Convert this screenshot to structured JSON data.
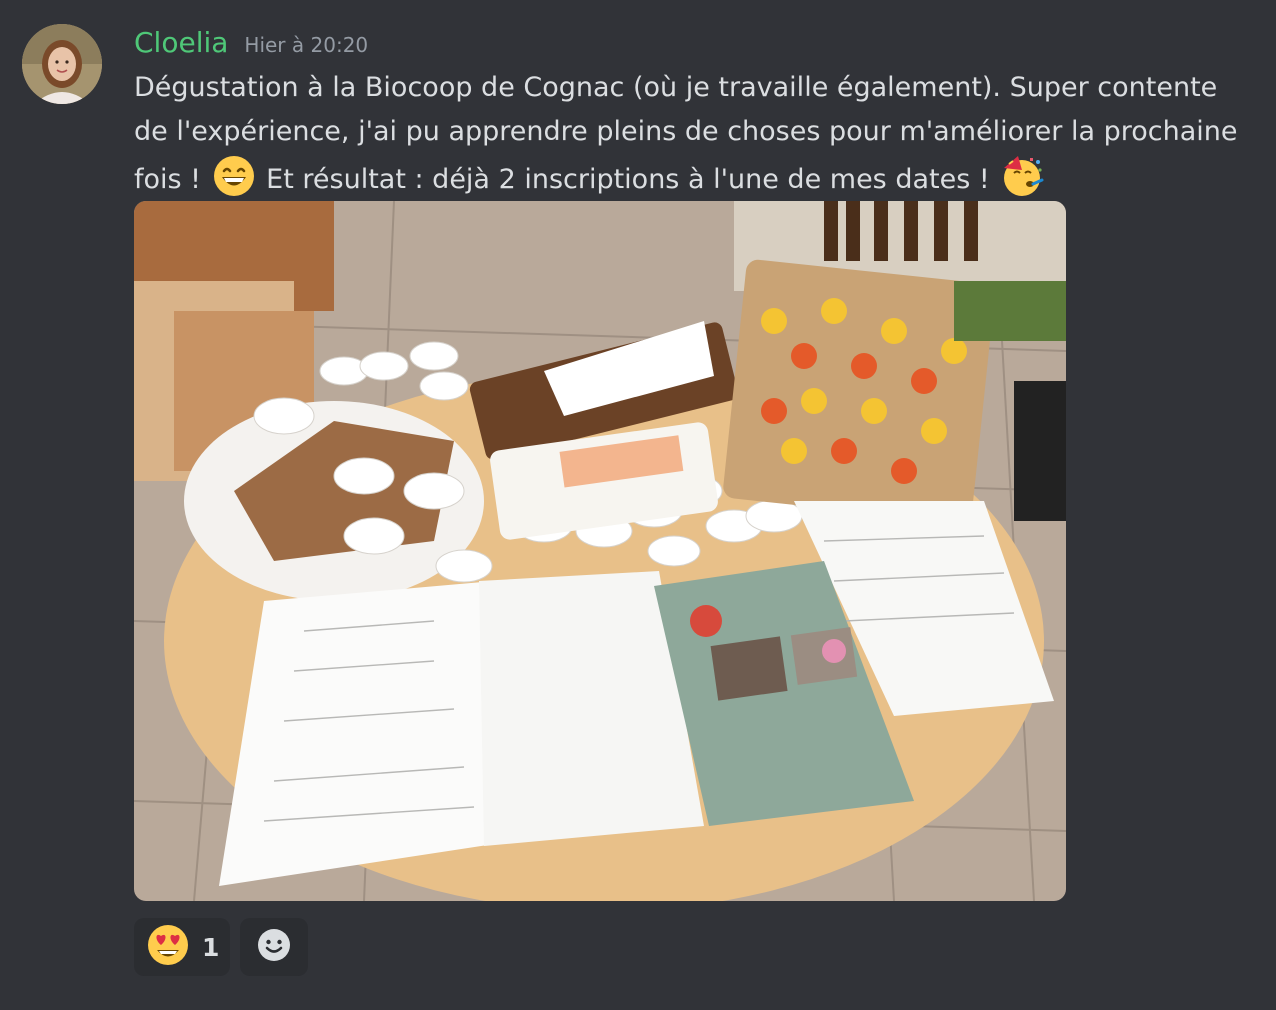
{
  "message": {
    "author": "Cloelia",
    "timestamp": "Hier à 20:20",
    "text_part1": "Dégustation à la Biocoop de Cognac (où je travaille également). Super contente de l'expérience, j'ai pu apprendre pleins de choses pour m'améliorer la prochaine fois ! ",
    "text_part2": " Et résultat : déjà 2 inscriptions à l'une de mes dates ! ",
    "emoji_1": "grinning-face-with-smiling-eyes",
    "emoji_2": "partying-face",
    "attachment_kind": "photo"
  },
  "reactions": [
    {
      "emoji": "smiling-face-with-heart-eyes",
      "count": "1"
    }
  ],
  "add_reaction_icon": "add-reaction-smiley-icon",
  "colors": {
    "background": "#313338",
    "username": "#4fc878",
    "timestamp": "#949ba4",
    "text": "#dbdee1",
    "reaction_bg": "#2b2d31"
  }
}
